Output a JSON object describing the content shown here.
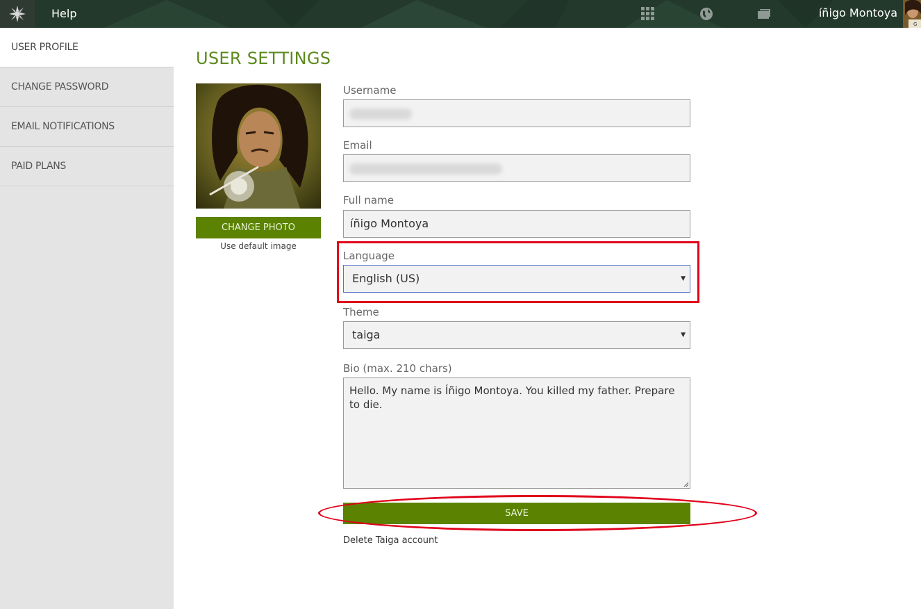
{
  "topbar": {
    "help_label": "Help",
    "user_name": "íñigo Montoya",
    "icons": [
      "taiga-logo-icon",
      "grid-icon",
      "globe-icon",
      "folder-icon"
    ]
  },
  "sidebar": {
    "items": [
      {
        "label": "USER PROFILE",
        "active": true
      },
      {
        "label": "CHANGE PASSWORD",
        "active": false
      },
      {
        "label": "EMAIL NOTIFICATIONS",
        "active": false
      },
      {
        "label": "PAID PLANS",
        "active": false
      }
    ]
  },
  "main": {
    "title": "USER SETTINGS",
    "change_photo_label": "CHANGE PHOTO",
    "default_image_label": "Use default image",
    "fields": {
      "username_label": "Username",
      "email_label": "Email",
      "fullname_label": "Full name",
      "fullname_value": "íñigo Montoya",
      "language_label": "Language",
      "language_value": "English (US)",
      "theme_label": "Theme",
      "theme_value": "taiga",
      "bio_label": "Bio (max. 210 chars)",
      "bio_value": "Hello. My name is Íñigo Montoya. You killed my father. Prepare to die."
    },
    "save_label": "SAVE",
    "delete_label": "Delete Taiga account"
  },
  "colors": {
    "accent_green": "#5b8200",
    "title_green": "#5b8a1d",
    "topbar": "#23392c",
    "highlight": "#e0001a"
  }
}
